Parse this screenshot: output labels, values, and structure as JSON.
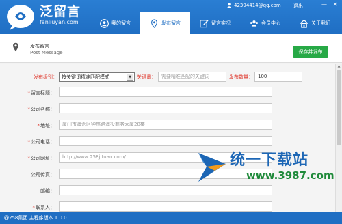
{
  "app": {
    "brand_name": "泛留言",
    "brand_url": "fanliuyan.com"
  },
  "account": {
    "email": "42394414@qq.com",
    "logout": "退出",
    "min": "—",
    "close": "✕"
  },
  "nav": [
    {
      "label": "我的留言",
      "icon": "person-circle-icon"
    },
    {
      "label": "发布留言",
      "icon": "location-pin-icon",
      "active": true
    },
    {
      "label": "留言实况",
      "icon": "edit-icon"
    },
    {
      "label": "会员中心",
      "icon": "members-icon"
    },
    {
      "label": "关于我们",
      "icon": "home-icon"
    }
  ],
  "page": {
    "title": "发布留言",
    "subtitle": "Post Message",
    "publish_button": "保存并发布"
  },
  "form": {
    "level_label": "发布级别：",
    "level_value": "按关键词精准匹配模式",
    "keyword_label": "关键词：",
    "keyword_placeholder": "需要精准匹配的关键词",
    "count_label": "发布数量：",
    "count_value": "100",
    "fields": [
      {
        "label": "留言标题：",
        "required": true,
        "value": ""
      },
      {
        "label": "公司名称：",
        "required": true,
        "value": ""
      },
      {
        "label": "地址：",
        "required": true,
        "value": "厦门市海沧区钟林路海投商务大厦28楼"
      },
      {
        "label": "公司电话：",
        "required": true,
        "value": ""
      },
      {
        "label": "公司网址：",
        "required": true,
        "value": "http://www.258jituan.com/"
      },
      {
        "label": "公司传真：",
        "required": false,
        "value": ""
      },
      {
        "label": "邮编：",
        "required": false,
        "value": ""
      },
      {
        "label": "联系人：",
        "required": true,
        "value": ""
      }
    ]
  },
  "watermark": {
    "text": "统一下载站",
    "url": "www.3987.com"
  },
  "footer": {
    "text": "@258集团 主程序版本 1.0.0"
  },
  "colors": {
    "header_blue": "#1f6ec3",
    "publish_green": "#27a946",
    "required_red": "#e03c31"
  }
}
